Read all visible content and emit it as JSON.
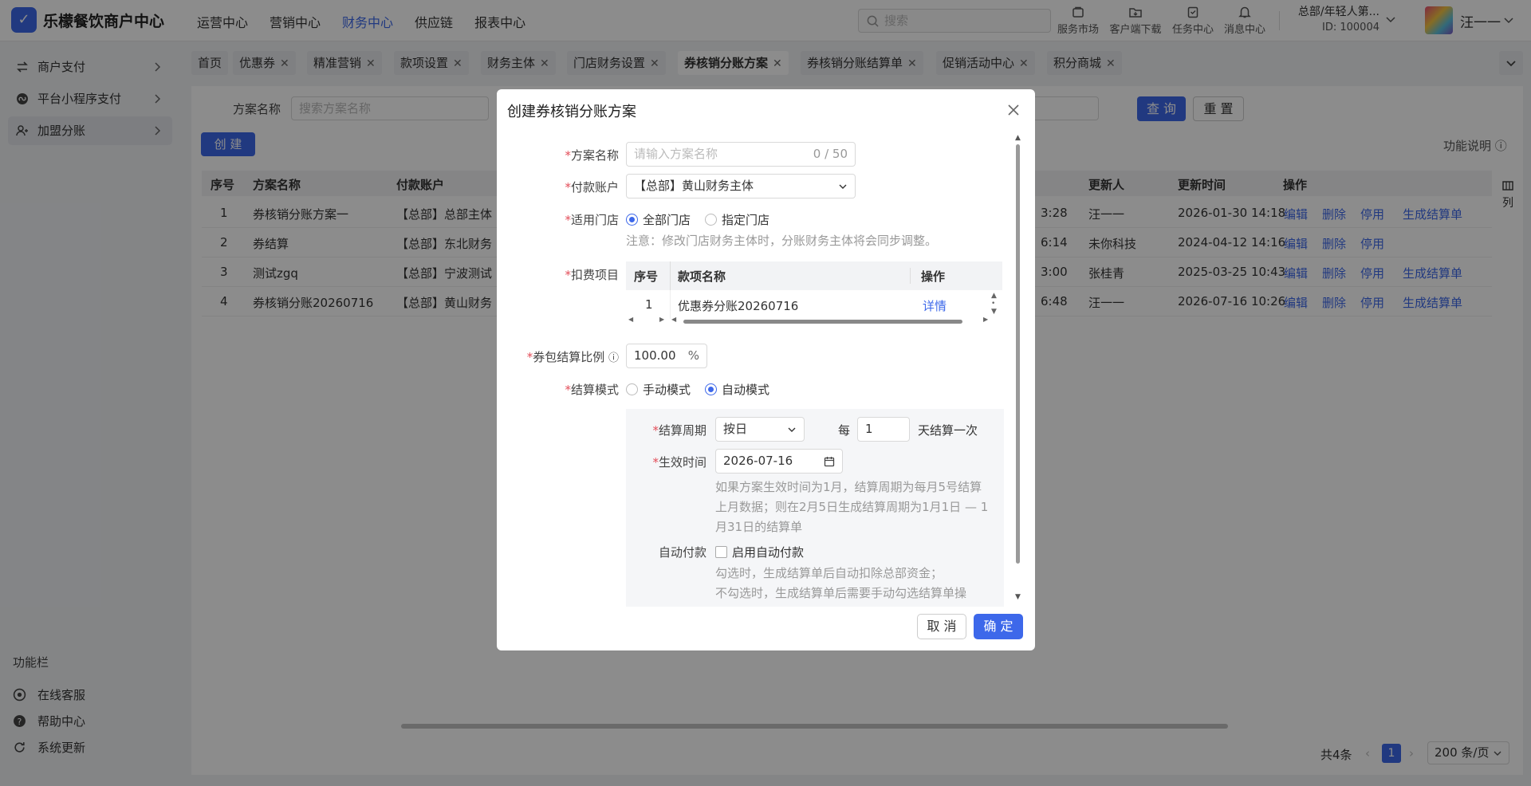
{
  "topbar": {
    "brand": "乐檬餐饮商户中心",
    "nav": [
      "运营中心",
      "营销中心",
      "财务中心",
      "供应链",
      "报表中心"
    ],
    "nav_active_index": 2,
    "search_placeholder": "搜索",
    "tools": [
      "服务市场",
      "客户端下载",
      "任务中心",
      "消息中心"
    ],
    "org_name": "总部/年轻人第...",
    "org_id": "ID: 100004",
    "username": "汪一一"
  },
  "sidebar": {
    "items": [
      "商户支付",
      "平台小程序支付",
      "加盟分账"
    ],
    "active_index": 2,
    "footer_label": "功能栏",
    "footer_items": [
      "在线客服",
      "帮助中心",
      "系统更新"
    ]
  },
  "tabs": [
    "首页",
    "优惠券",
    "精准营销",
    "款项设置",
    "财务主体",
    "门店财务设置",
    "券核销分账方案",
    "券核销分账结算单",
    "促销活动中心",
    "积分商城"
  ],
  "active_tab_index": 6,
  "filter": {
    "label": "方案名称",
    "placeholder": "搜索方案名称",
    "query_label": "查 询",
    "reset_label": "重 置"
  },
  "create_label": "创 建",
  "help_label": "功能说明",
  "table": {
    "headers": {
      "index": "序号",
      "name": "方案名称",
      "account": "付款账户",
      "updater": "更新人",
      "updated": "更新时间",
      "ops": "操作"
    },
    "rows": [
      {
        "index": "1",
        "name": "券核销分账方案一",
        "account": "【总部】总部主体",
        "time_tail": "3:28",
        "updater": "汪一一",
        "updated": "2026-01-30 14:18",
        "ops": [
          "编辑",
          "删除",
          "停用",
          "生成结算单"
        ]
      },
      {
        "index": "2",
        "name": "券结算",
        "account": "【总部】东北财务",
        "time_tail": "6:14",
        "updater": "未你科技",
        "updated": "2024-04-12 14:16",
        "ops": [
          "编辑",
          "删除",
          "停用"
        ]
      },
      {
        "index": "3",
        "name": "测试zgq",
        "account": "【总部】宁波测试",
        "time_tail": "3:00",
        "updater": "张桂青",
        "updated": "2025-03-25 10:43",
        "ops": [
          "编辑",
          "删除",
          "停用",
          "生成结算单"
        ]
      },
      {
        "index": "4",
        "name": "券核销分账20260716",
        "account": "【总部】黄山财务",
        "time_tail": "6:48",
        "updater": "汪一一",
        "updated": "2026-07-16 10:26",
        "ops": [
          "编辑",
          "删除",
          "停用",
          "生成结算单"
        ]
      }
    ],
    "column_toggle": "列"
  },
  "pagination": {
    "total": "共4条",
    "page": "1",
    "page_size": "200 条/页"
  },
  "modal": {
    "title": "创建券核销分账方案",
    "name_label": "方案名称",
    "name_placeholder": "请输入方案名称",
    "name_count": "0 / 50",
    "account_label": "付款账户",
    "account_value": "【总部】黄山财务主体",
    "store_label": "适用门店",
    "store_options": [
      "全部门店",
      "指定门店"
    ],
    "store_selected_index": 0,
    "store_note": "注意：修改门店财务主体时，分账财务主体将会同步调整。",
    "deduct_label": "扣费项目",
    "deduct_headers": [
      "序号",
      "款项名称",
      "操作"
    ],
    "deduct_rows": [
      {
        "index": "1",
        "name": "优惠券分账20260716",
        "op": "详情"
      }
    ],
    "ratio_label": "券包结算比例",
    "ratio_value": "100.00",
    "ratio_unit": "%",
    "mode_label": "结算模式",
    "mode_options": [
      "手动模式",
      "自动模式"
    ],
    "mode_selected_index": 1,
    "cycle_label": "结算周期",
    "cycle_value": "按日",
    "every_prefix": "每",
    "every_value": "1",
    "every_suffix": "天结算一次",
    "effective_label": "生效时间",
    "effective_value": "2026-07-16",
    "effective_note": [
      "如果方案生效时间为1月，结算周期为每月5号结算",
      "上月数据；则在2月5日生成结算周期为1月1日 — 1",
      "月31日的结算单"
    ],
    "autopay_label": "自动付款",
    "autopay_checkbox": "启用自动付款",
    "autopay_checked": false,
    "autopay_note": [
      "勾选时，生成结算单后自动扣除总部资金；",
      "不勾选时，生成结算单后需要手动勾选结算单操"
    ],
    "cancel_label": "取 消",
    "confirm_label": "确 定"
  },
  "colors": {
    "accent": "#3d68ea",
    "required": "#e34d59"
  }
}
